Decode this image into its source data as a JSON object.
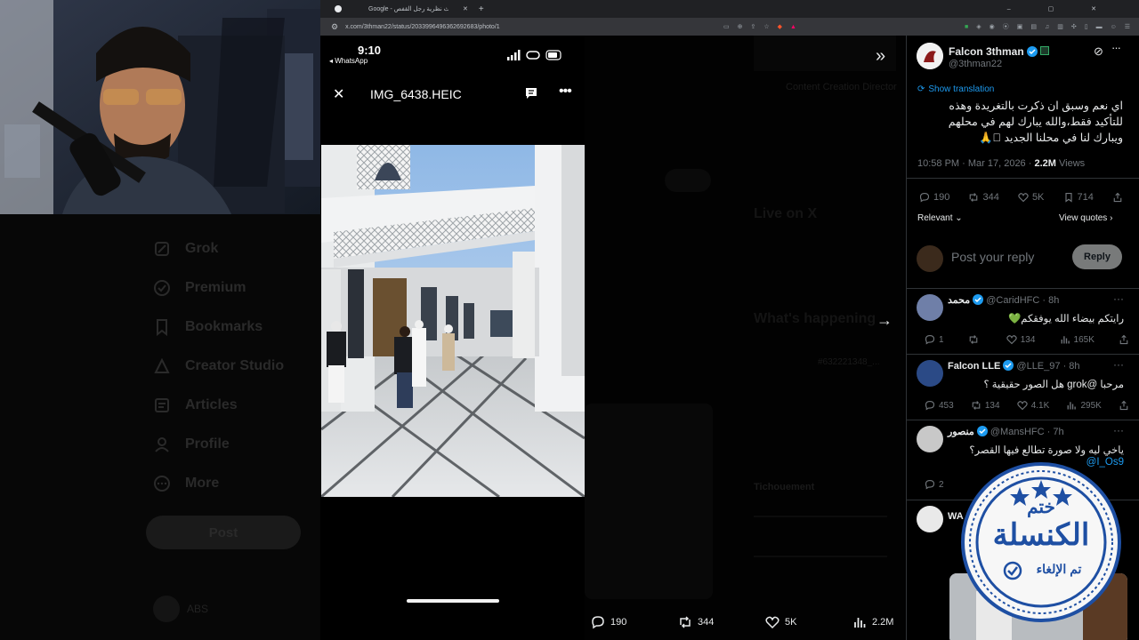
{
  "browser": {
    "tab_title": "Google - بحث نظرية رجل القفص",
    "url": "x.com/3thman22/status/2033996496362692683/photo/1"
  },
  "sidebar": {
    "items": [
      {
        "label": "Grok",
        "icon": "grok-icon"
      },
      {
        "label": "Premium",
        "icon": "premium-icon"
      },
      {
        "label": "Bookmarks",
        "icon": "bookmark-icon"
      },
      {
        "label": "Creator Studio",
        "icon": "creator-studio-icon"
      },
      {
        "label": "Articles",
        "icon": "articles-icon"
      },
      {
        "label": "Profile",
        "icon": "profile-icon"
      },
      {
        "label": "More",
        "icon": "more-circle-icon"
      }
    ],
    "post_label": "Post",
    "user_label": "ABS"
  },
  "phone": {
    "time": "9:10",
    "back_label": "◂ WhatsApp",
    "filename": "IMG_6438.HEIC"
  },
  "photo_actions": {
    "replies": "190",
    "reposts": "344",
    "likes": "5K",
    "views": "2.2M"
  },
  "background_feed": {
    "live_on_x": "Live on X",
    "whats_happening": "What's happening",
    "hashtag": "#632221348_...",
    "tichouement": "Tichouement",
    "content_creation": "Content Creation Director"
  },
  "post": {
    "author_name": "Falcon 3thman",
    "handle": "@3thman22",
    "show_translation": "Show translation",
    "text": "اي نعم وسبق ان ذكرت بالتغريدة وهذه للتأكيد فقط،والله يبارك لهم في محلهم ويبارك لنا في محلنا الجديد 🏽🙏",
    "time": "10:58 PM · Mar 17, 2026",
    "views_count": "2.2M",
    "views_label": "Views",
    "replies": "190",
    "reposts": "344",
    "likes": "5K",
    "bookmarks": "714",
    "relevant_label": "Relevant",
    "view_quotes_label": "View quotes",
    "reply_placeholder": "Post your reply",
    "reply_button": "Reply"
  },
  "replies": [
    {
      "name": "محمد",
      "handle": "@CaridHFC",
      "time": "· 8h",
      "text": "رايتكم بيضاء الله يوفقكم💚",
      "mention": "",
      "replies": "1",
      "reposts": "",
      "likes": "134",
      "views": "165K"
    },
    {
      "name": "Falcon LLE",
      "handle": "@LLE_97",
      "time": "· 8h",
      "text": "مرحبا @grok هل الصور حقيقية ؟",
      "mention": "",
      "replies": "453",
      "reposts": "134",
      "likes": "4.1K",
      "views": "295K"
    },
    {
      "name": "منصور",
      "handle": "@MansHFC",
      "time": "· 7h",
      "text": "ياخي ليه ولا صورة تطالع فيها القصر؟",
      "mention": "@I_Os9",
      "replies": "2",
      "reposts": "",
      "likes": "",
      "views": ""
    },
    {
      "name": "WA",
      "handle": "",
      "time": "",
      "text": "",
      "mention": "",
      "replies": "",
      "reposts": "",
      "likes": "",
      "views": ""
    }
  ],
  "stamp": {
    "top_text": "ختم",
    "main_text": "الكنسلة",
    "bottom_text": "تم الإلغاء"
  },
  "colors": {
    "accent": "#1d9bf0",
    "background": "#000000",
    "muted": "#71767b",
    "stamp_blue": "#1e4fa3"
  }
}
